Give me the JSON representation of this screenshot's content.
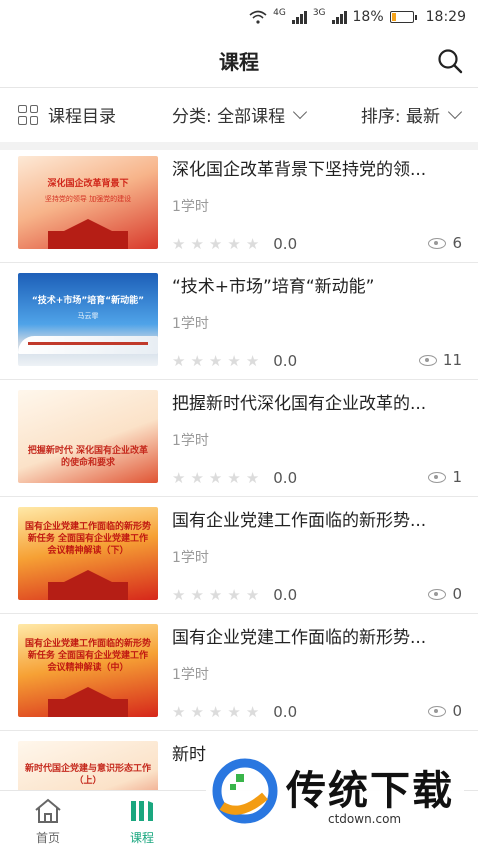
{
  "status": {
    "network1": "4G",
    "network2": "3G",
    "battery": "18%",
    "battery_level": 0.18,
    "time": "18:29",
    "battery_color": "#f5a31a"
  },
  "header": {
    "title": "课程"
  },
  "filters": {
    "catalog": "课程目录",
    "category": "分类: 全部课程",
    "sort": "排序: 最新"
  },
  "courses": [
    {
      "title": "深化国企改革背景下坚持党的领...",
      "hours": "1学时",
      "rating": "0.0",
      "views": "6",
      "thumb_title": "深化国企改革背景下",
      "thumb_sub": "坚持党的领导 加强党的建设"
    },
    {
      "title": "“技术+市场”培育“新动能”",
      "hours": "1学时",
      "rating": "0.0",
      "views": "11",
      "thumb_title": "“技术+市场”培育“新动能”",
      "thumb_sub": "马云霏"
    },
    {
      "title": "把握新时代深化国有企业改革的...",
      "hours": "1学时",
      "rating": "0.0",
      "views": "1",
      "thumb_title": "把握新时代 深化国有企业改革的使命和要求",
      "thumb_sub": ""
    },
    {
      "title": "国有企业党建工作面临的新形势...",
      "hours": "1学时",
      "rating": "0.0",
      "views": "0",
      "thumb_title": "国有企业党建工作面临的新形势新任务 全面国有企业党建工作会议精神解读（下）",
      "thumb_sub": ""
    },
    {
      "title": "国有企业党建工作面临的新形势...",
      "hours": "1学时",
      "rating": "0.0",
      "views": "0",
      "thumb_title": "国有企业党建工作面临的新形势新任务 全面国有企业党建工作会议精神解读（中）",
      "thumb_sub": ""
    },
    {
      "title": "新时",
      "hours": "",
      "rating": "",
      "views": "",
      "thumb_title": "新时代国企党建与意识形态工作（上）",
      "thumb_sub": ""
    }
  ],
  "tabs": {
    "home": "首页",
    "course": "课程"
  },
  "accent": "#1aa77f",
  "watermark": {
    "brand": "传统下载",
    "url": "ctdown.com"
  }
}
